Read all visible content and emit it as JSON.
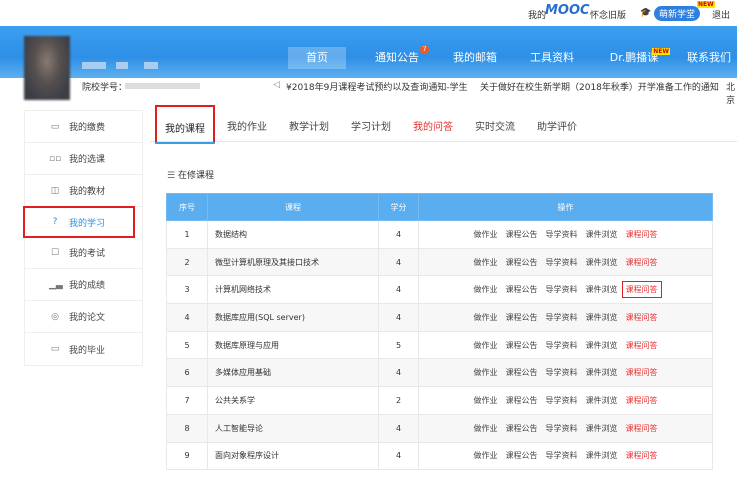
{
  "topbar": {
    "my_label": "我的",
    "mooc_logo": "MOOC",
    "old_version": "怀念旧版",
    "new_learning": "萌新学堂",
    "new_badge": "NEW",
    "logout": "退出"
  },
  "nav": [
    {
      "label": "首页",
      "active": true
    },
    {
      "label": "通知公告",
      "badge": "7"
    },
    {
      "label": "我的邮箱"
    },
    {
      "label": "工具资料"
    },
    {
      "label": "Dr.鹏播课",
      "badge": "NEW"
    },
    {
      "label": "联系我们"
    }
  ],
  "profile": {
    "id_label": "院校学号："
  },
  "ticker": [
    "¥2018年9月课程考试预约以及查询通知-学生",
    "关于做好在校生新学期（2018年秋季）开学准备工作的通知",
    "北京"
  ],
  "sidebar": [
    {
      "label": "我的缴费",
      "icon": "wallet-icon"
    },
    {
      "label": "我的选课",
      "icon": "grid-icon"
    },
    {
      "label": "我的教材",
      "icon": "book-icon"
    },
    {
      "label": "我的学习",
      "icon": "head-icon",
      "active": true
    },
    {
      "label": "我的考试",
      "icon": "exam-icon"
    },
    {
      "label": "我的成绩",
      "icon": "chart-icon"
    },
    {
      "label": "我的论文",
      "icon": "paper-icon"
    },
    {
      "label": "我的毕业",
      "icon": "graduation-icon"
    }
  ],
  "tabs": [
    {
      "label": "我的课程",
      "active": true
    },
    {
      "label": "我的作业"
    },
    {
      "label": "教学计划"
    },
    {
      "label": "学习计划"
    },
    {
      "label": "我的问答",
      "highlight": true
    },
    {
      "label": "实时交流"
    },
    {
      "label": "助学评价"
    }
  ],
  "section_title": "在修课程",
  "table": {
    "headers": [
      "序号",
      "课程",
      "学分",
      "操作"
    ],
    "actions": [
      "做作业",
      "课程公告",
      "导学资料",
      "课件浏览",
      "课程问答"
    ],
    "rows": [
      {
        "no": "1",
        "course": "数据结构",
        "credit": "4"
      },
      {
        "no": "2",
        "course": "微型计算机原理及其接口技术",
        "credit": "4"
      },
      {
        "no": "3",
        "course": "计算机网络技术",
        "credit": "4"
      },
      {
        "no": "4",
        "course": "数据库应用(SQL server)",
        "credit": "4"
      },
      {
        "no": "5",
        "course": "数据库原理与应用",
        "credit": "5"
      },
      {
        "no": "6",
        "course": "多媒体应用基础",
        "credit": "4"
      },
      {
        "no": "7",
        "course": "公共关系学",
        "credit": "2"
      },
      {
        "no": "8",
        "course": "人工智能导论",
        "credit": "4"
      },
      {
        "no": "9",
        "course": "面向对象程序设计",
        "credit": "4"
      }
    ]
  },
  "colors": {
    "primary": "#2d8fe6",
    "table_header": "#5aaef0",
    "highlight_red": "#e83030"
  }
}
